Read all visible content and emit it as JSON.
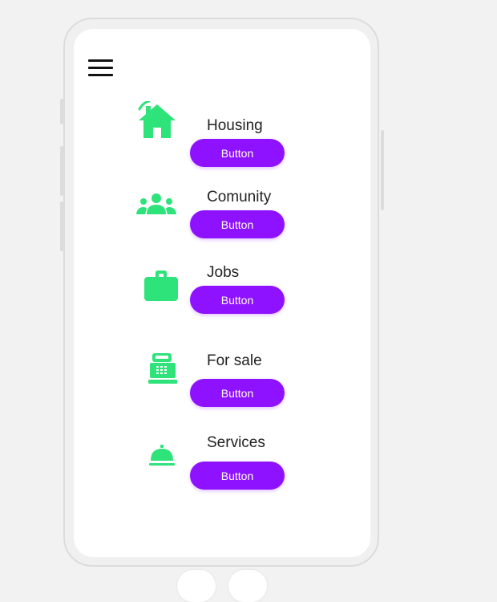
{
  "menu": {
    "icon": "hamburger-menu-icon"
  },
  "categories": [
    {
      "key": "housing",
      "label": "Housing",
      "button_label": "Button",
      "icon": "house-icon"
    },
    {
      "key": "community",
      "label": "Comunity",
      "button_label": "Button",
      "icon": "people-group-icon"
    },
    {
      "key": "jobs",
      "label": "Jobs",
      "button_label": "Button",
      "icon": "briefcase-icon"
    },
    {
      "key": "forsale",
      "label": "For sale",
      "button_label": "Button",
      "icon": "cash-register-icon"
    },
    {
      "key": "services",
      "label": "Services",
      "button_label": "Button",
      "icon": "service-bell-icon"
    }
  ],
  "colors": {
    "accent_button": "#8e12ff",
    "icon_green": "#2ee37a",
    "page_background": "#f2f2f2",
    "screen_background": "#ffffff"
  }
}
